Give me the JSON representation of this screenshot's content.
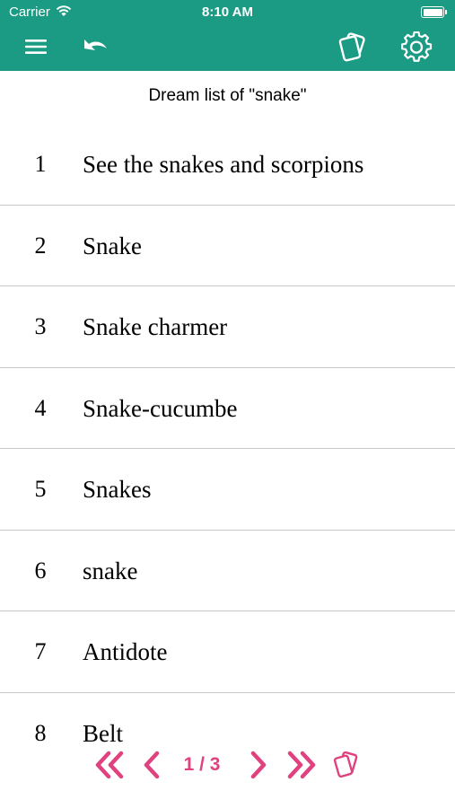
{
  "status_bar": {
    "carrier": "Carrier",
    "time": "8:10 AM"
  },
  "nav": {
    "menu_icon": "hamburger-menu-icon",
    "back_icon": "undo-arrow-icon",
    "cards_icon": "cards-icon",
    "settings_icon": "gear-icon"
  },
  "header": {
    "title": "Dream list of \"snake\""
  },
  "list": {
    "items": [
      {
        "number": "1",
        "label": "See the snakes and scorpions"
      },
      {
        "number": "2",
        "label": "Snake"
      },
      {
        "number": "3",
        "label": "Snake charmer"
      },
      {
        "number": "4",
        "label": "Snake-cucumbe"
      },
      {
        "number": "5",
        "label": "Snakes"
      },
      {
        "number": "6",
        "label": "snake"
      },
      {
        "number": "7",
        "label": "Antidote"
      },
      {
        "number": "8",
        "label": "Belt"
      }
    ]
  },
  "pager": {
    "pages": "1 / 3"
  },
  "colors": {
    "header_bg": "#1b9b84",
    "pager_accent": "#e0417f",
    "divider": "#c8c8cc"
  }
}
